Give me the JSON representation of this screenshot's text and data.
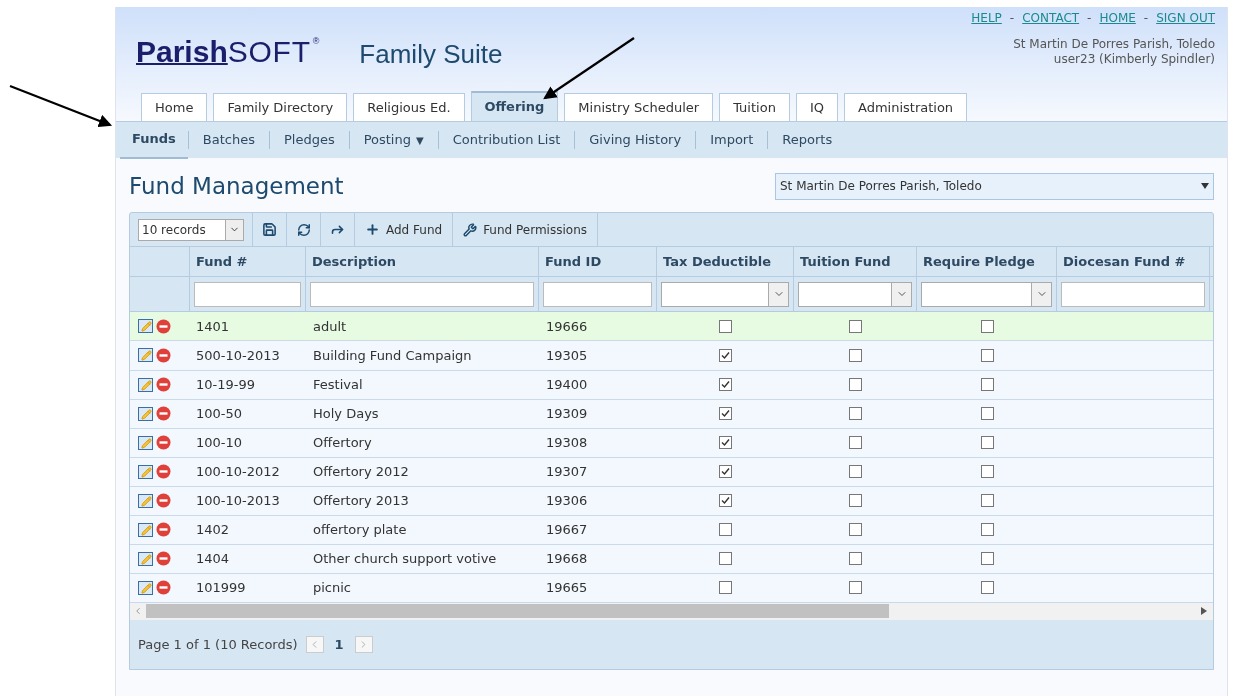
{
  "header": {
    "logo": {
      "bold": "Parish",
      "light": "SOFT",
      "mark": "®"
    },
    "suite_title": "Family Suite",
    "top_links": [
      "HELP",
      "CONTACT",
      "HOME",
      "SIGN OUT"
    ],
    "separator": "-",
    "parish": "St Martin De Porres Parish, Toledo",
    "user": "user23 (Kimberly Spindler)"
  },
  "tabs": [
    {
      "label": "Home",
      "selected": false
    },
    {
      "label": "Family Directory",
      "selected": false
    },
    {
      "label": "Religious Ed.",
      "selected": false
    },
    {
      "label": "Offering",
      "selected": true
    },
    {
      "label": "Ministry Scheduler",
      "selected": false
    },
    {
      "label": "Tuition",
      "selected": false
    },
    {
      "label": "IQ",
      "selected": false
    },
    {
      "label": "Administration",
      "selected": false
    }
  ],
  "subnav": [
    {
      "label": "Funds",
      "selected": true
    },
    {
      "label": "Batches",
      "selected": false
    },
    {
      "label": "Pledges",
      "selected": false
    },
    {
      "label": "Posting",
      "selected": false,
      "caret": "▼"
    },
    {
      "label": "Contribution List",
      "selected": false
    },
    {
      "label": "Giving History",
      "selected": false
    },
    {
      "label": "Import",
      "selected": false
    },
    {
      "label": "Reports",
      "selected": false
    }
  ],
  "page_title": "Fund Management",
  "parish_select": {
    "value": "St Martin De Porres Parish, Toledo"
  },
  "toolbar": {
    "page_size": "10 records",
    "add_label": "Add Fund",
    "permissions_label": "Fund Permissions"
  },
  "table": {
    "columns": [
      {
        "label": "Fund #",
        "kind": "text"
      },
      {
        "label": "Description",
        "kind": "text"
      },
      {
        "label": "Fund ID",
        "kind": "text"
      },
      {
        "label": "Tax Deductible",
        "kind": "select"
      },
      {
        "label": "Tuition Fund",
        "kind": "select"
      },
      {
        "label": "Require Pledge",
        "kind": "select"
      },
      {
        "label": "Diocesan Fund #",
        "kind": "text"
      }
    ],
    "rows": [
      {
        "fund_no": "1401",
        "description": "adult",
        "fund_id": "19666",
        "tax_deductible": false,
        "tuition_fund": false,
        "require_pledge": false,
        "selected": true
      },
      {
        "fund_no": "500-10-2013",
        "description": "Building Fund Campaign",
        "fund_id": "19305",
        "tax_deductible": true,
        "tuition_fund": false,
        "require_pledge": false,
        "selected": false
      },
      {
        "fund_no": "10-19-99",
        "description": "Festival",
        "fund_id": "19400",
        "tax_deductible": true,
        "tuition_fund": false,
        "require_pledge": false,
        "selected": false
      },
      {
        "fund_no": "100-50",
        "description": "Holy Days",
        "fund_id": "19309",
        "tax_deductible": true,
        "tuition_fund": false,
        "require_pledge": false,
        "selected": false
      },
      {
        "fund_no": "100-10",
        "description": "Offertory",
        "fund_id": "19308",
        "tax_deductible": true,
        "tuition_fund": false,
        "require_pledge": false,
        "selected": false
      },
      {
        "fund_no": "100-10-2012",
        "description": "Offertory 2012",
        "fund_id": "19307",
        "tax_deductible": true,
        "tuition_fund": false,
        "require_pledge": false,
        "selected": false
      },
      {
        "fund_no": "100-10-2013",
        "description": "Offertory 2013",
        "fund_id": "19306",
        "tax_deductible": true,
        "tuition_fund": false,
        "require_pledge": false,
        "selected": false
      },
      {
        "fund_no": "1402",
        "description": "offertory plate",
        "fund_id": "19667",
        "tax_deductible": false,
        "tuition_fund": false,
        "require_pledge": false,
        "selected": false
      },
      {
        "fund_no": "1404",
        "description": "Other church support votive",
        "fund_id": "19668",
        "tax_deductible": false,
        "tuition_fund": false,
        "require_pledge": false,
        "selected": false
      },
      {
        "fund_no": "101999",
        "description": "picnic",
        "fund_id": "19665",
        "tax_deductible": false,
        "tuition_fund": false,
        "require_pledge": false,
        "selected": false
      }
    ]
  },
  "pager": {
    "summary": "Page 1 of 1 (10 Records)",
    "current": "1"
  }
}
